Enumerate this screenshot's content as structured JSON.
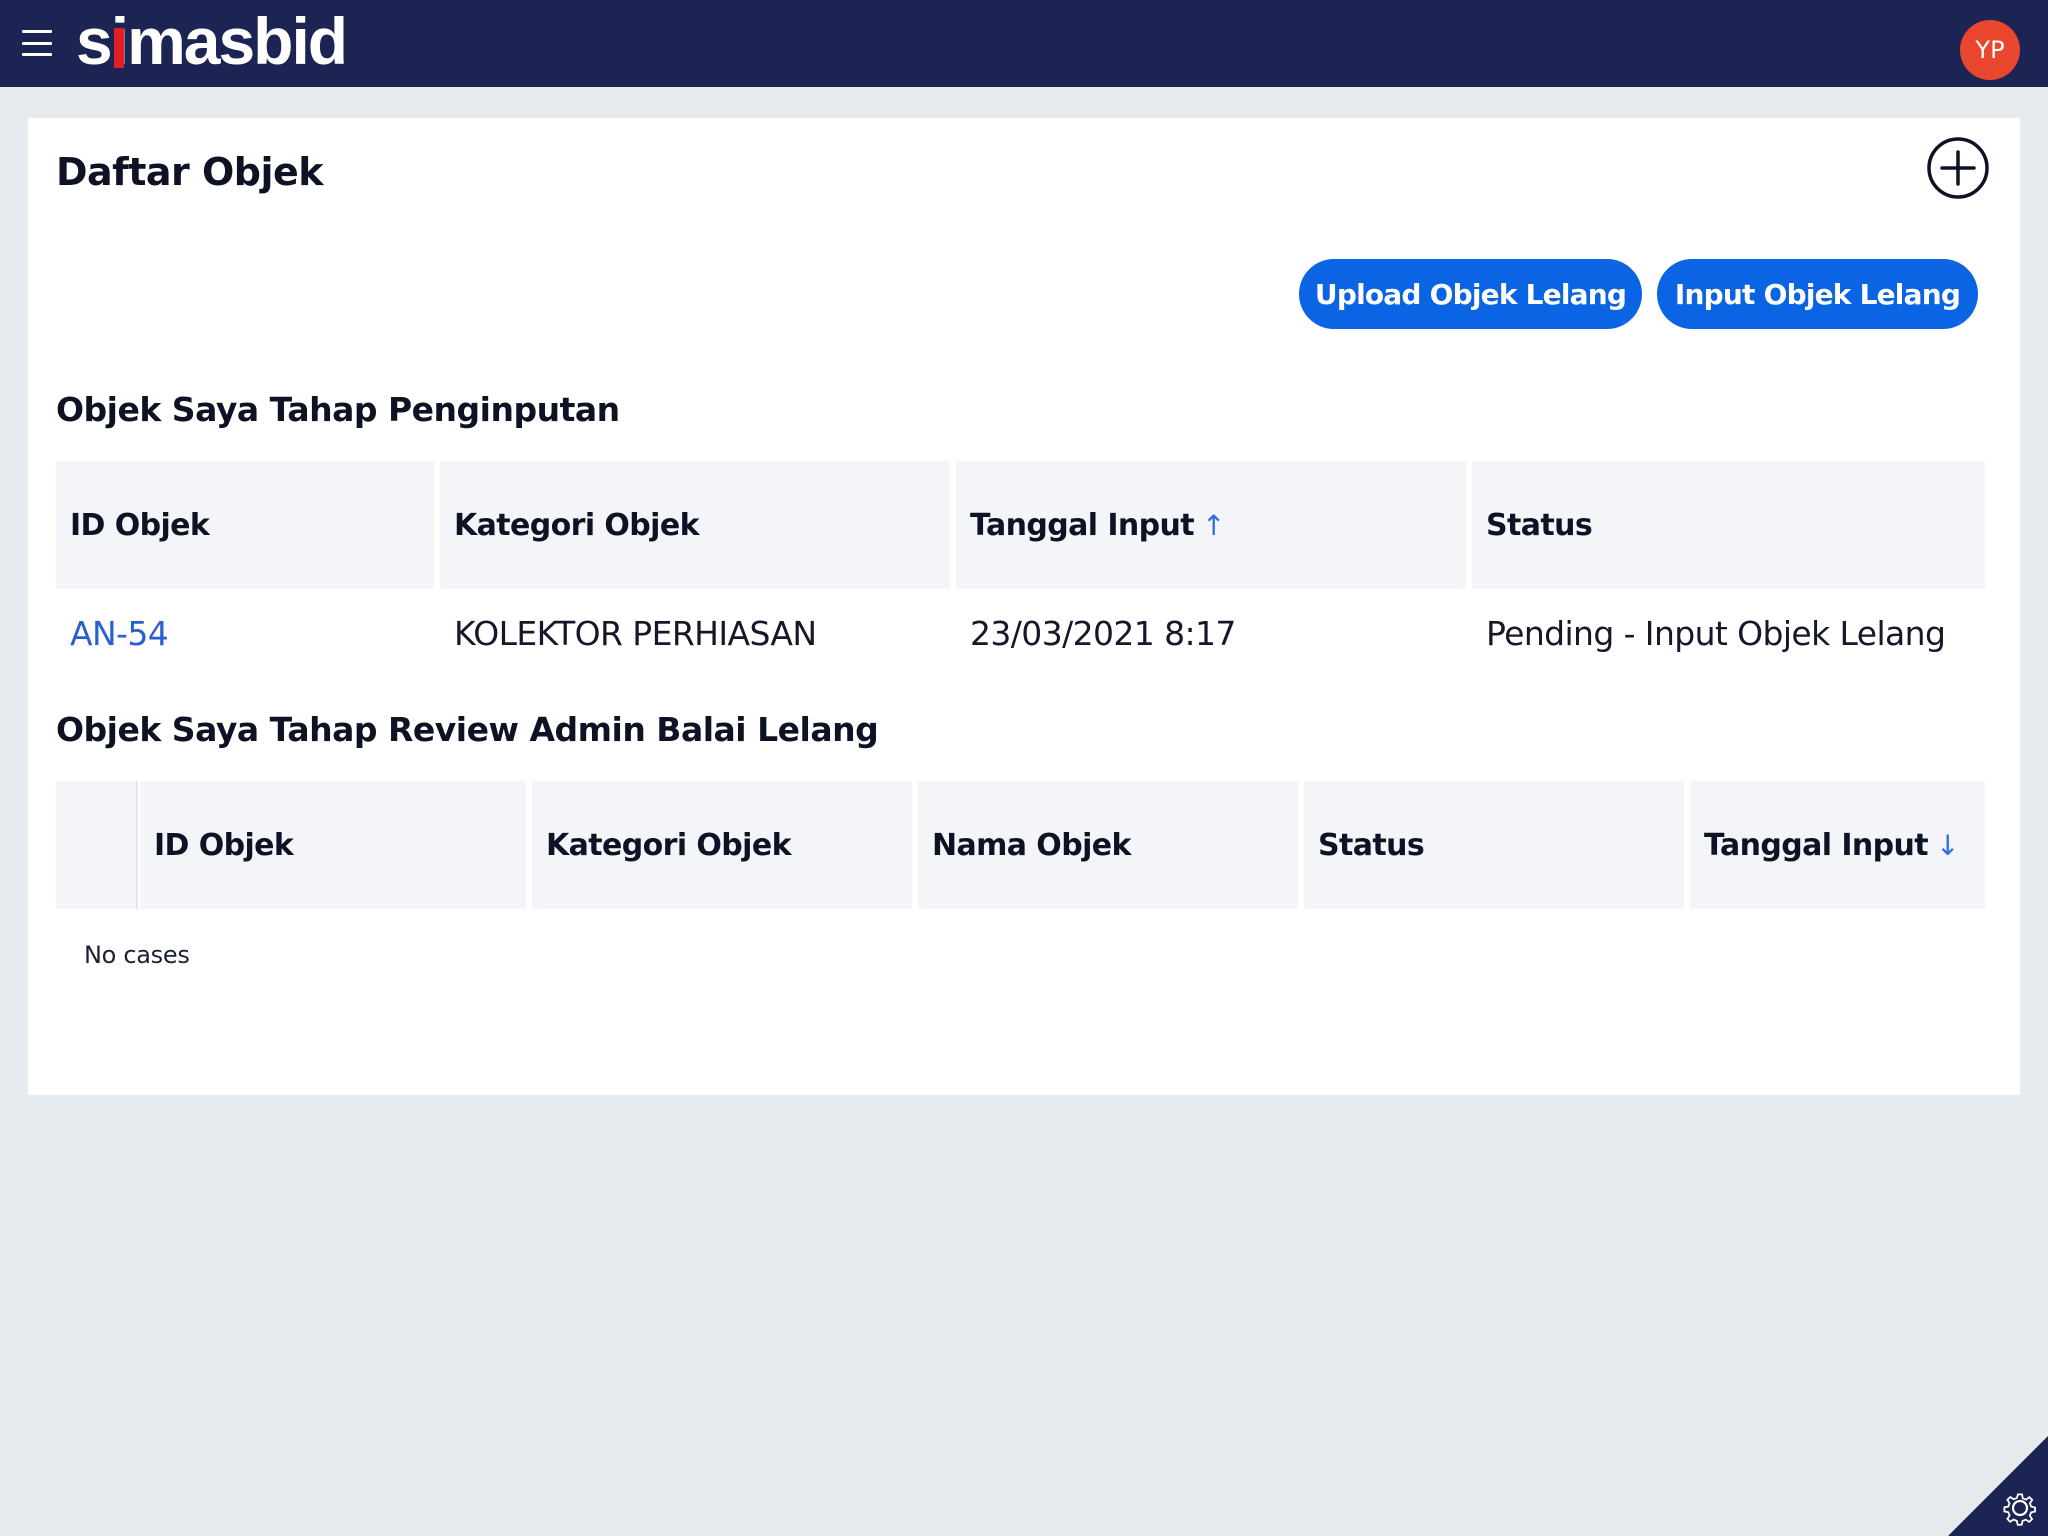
{
  "app": {
    "logo_first": "s",
    "logo_i": "i",
    "logo_rest": "masbid",
    "user_initials": "YP",
    "colors": {
      "topbar": "#1c2454",
      "accent": "#0a64e4",
      "avatar": "#e8462d",
      "logo_dot": "#e21f26",
      "link": "#2a5fd0"
    }
  },
  "page": {
    "title": "Daftar Objek",
    "add_icon": "plus-circle-icon",
    "buttons": {
      "upload": "Upload Objek Lelang",
      "input": "Input Objek Lelang"
    }
  },
  "section_input": {
    "title": "Objek Saya Tahap Penginputan",
    "columns": [
      "ID Objek",
      "Kategori Objek",
      "Tanggal Input",
      "Status"
    ],
    "sort_icon": "↑",
    "rows": [
      {
        "id": "AN-54",
        "kategori": "KOLEKTOR PERHIASAN",
        "tanggal": "23/03/2021 8:17",
        "status": "Pending - Input Objek Lelang"
      }
    ]
  },
  "section_review": {
    "title": "Objek Saya Tahap Review Admin Balai Lelang",
    "columns": [
      "ID Objek",
      "Kategori Objek",
      "Nama Objek",
      "Status",
      "Tanggal Input"
    ],
    "sort_icon": "↓",
    "empty_text": "No cases"
  },
  "settings_icon": "gear-icon"
}
